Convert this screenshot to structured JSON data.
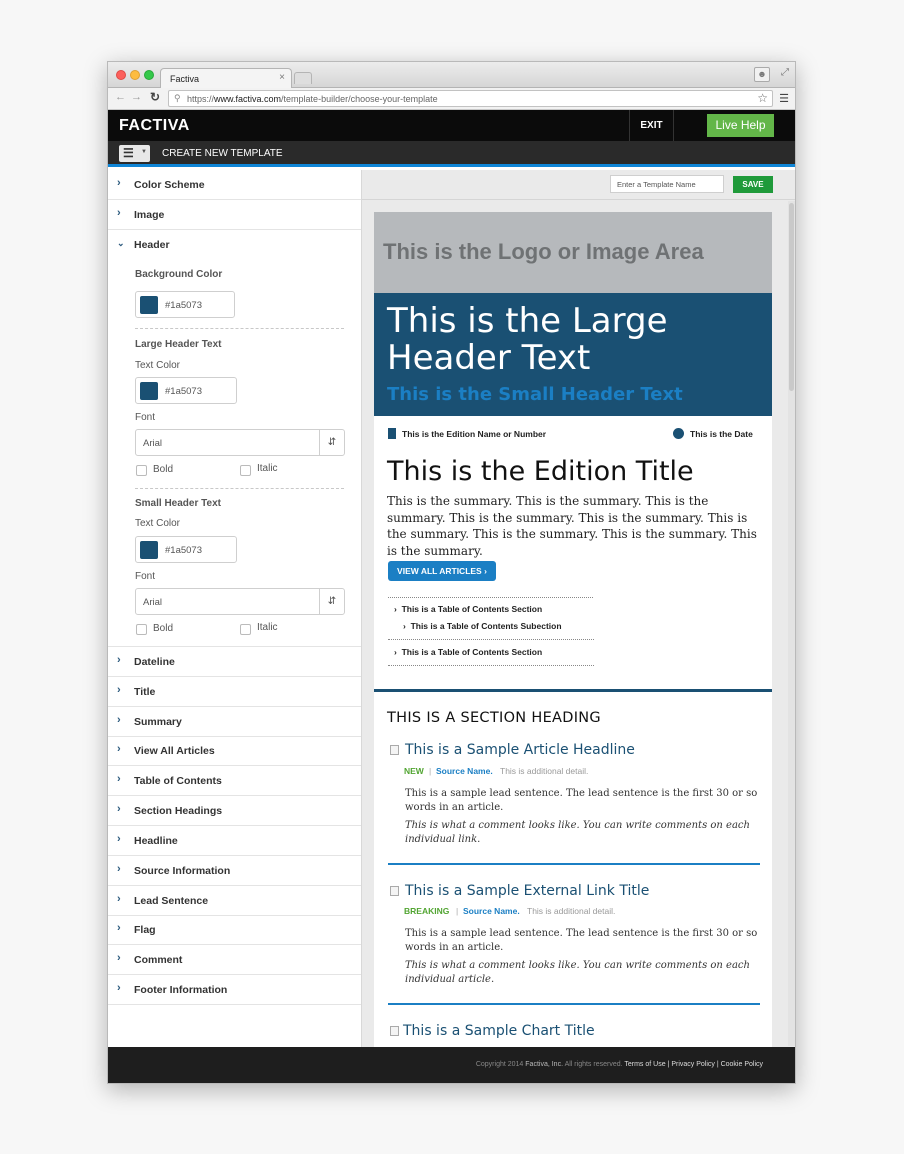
{
  "browser": {
    "tab_title": "Factiva",
    "tab_close": "×",
    "url_prefix": "https://",
    "url_host": "www.factiva.com",
    "url_path": "/template-builder/choose-your-template"
  },
  "app": {
    "logo": "FACTIVA",
    "exit_label": "EXIT",
    "help_label": "Live Help",
    "create_label": "CREATE NEW TEMPLATE"
  },
  "sidebar": {
    "color_scheme": "Color Scheme",
    "image": "Image",
    "header": "Header",
    "background_color_label": "Background Color",
    "background_color_value": "#1a5073",
    "large_header_label": "Large Header Text",
    "text_color_label": "Text Color",
    "large_text_color": "#1a5073",
    "font_label": "Font",
    "large_font": "Arial",
    "bold_label": "Bold",
    "italic_label": "Italic",
    "small_header_label": "Small Header Text",
    "small_text_color": "#1a5073",
    "small_font": "Arial",
    "items": [
      "Dateline",
      "Title",
      "Summary",
      "View All Articles",
      "Table of Contents",
      "Section Headings",
      "Headline",
      "Source Information",
      "Lead Sentence",
      "Flag",
      "Comment",
      "Footer Information"
    ]
  },
  "main": {
    "template_name_placeholder": "Enter a Template Name",
    "save_label": "SAVE"
  },
  "preview": {
    "logo_area": "This is the Logo or Image Area",
    "large_header": "This is the Large Header Text",
    "small_header": "This is the Small Header Text",
    "edition_name": "This is the Edition Name or Number",
    "date": "This is the Date",
    "edition_title": "This is the Edition Title",
    "summary": "This is the summary. This is the summary. This is the summary. This is the summary. This is the summary. This is the summary. This is the summary. This is the summary. This is the summary.",
    "view_all": "VIEW ALL ARTICLES ›",
    "toc": [
      "This is a Table of Contents Section",
      "This is a Table of Contents Subection",
      "This is a Table of Contents Section"
    ],
    "section_heading": "THIS IS A SECTION HEADING",
    "articles": [
      {
        "title": "This is a Sample Article Headline",
        "flag": "NEW",
        "source": "Source Name.",
        "detail": "This is additional detail.",
        "lead": "This is a sample lead sentence. The lead sentence is the first 30 or so words in an article.",
        "comment": "This is what a comment looks like. You can write comments on each individual link."
      },
      {
        "title": "This is a Sample External Link Title",
        "flag": "BREAKING",
        "source": "Source Name.",
        "detail": "This is additional detail.",
        "lead": "This is a sample lead sentence. The lead sentence is the first 30 or so words in an article.",
        "comment": "This is what a comment looks like. You can write comments on each individual article."
      },
      {
        "title": "This is a Sample Chart Title"
      }
    ]
  },
  "footer": {
    "copyright": "Copyright 2014",
    "company": "Factiva, Inc.",
    "rights": "All rights reserved.",
    "links": "Terms of Use | Privacy Policy | Cookie Policy"
  },
  "colors": {
    "header_bg": "#1a5073",
    "accent_blue": "#1b7fc4",
    "help_green": "#63b649",
    "save_green": "#1f9a3a"
  }
}
